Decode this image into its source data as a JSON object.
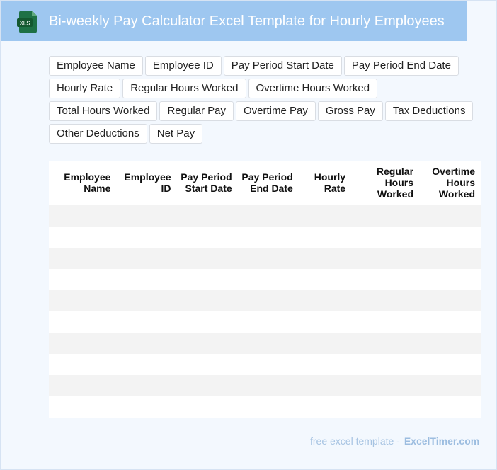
{
  "header": {
    "title": "Bi-weekly Pay Calculator Excel Template for Hourly Employees",
    "icon_label": "XLS",
    "icon_name": "excel-file-icon",
    "accent_color": "#9ec7f0",
    "icon_color": "#1e7145"
  },
  "fields": [
    "Employee Name",
    "Employee ID",
    "Pay Period Start Date",
    "Pay Period End Date",
    "Hourly Rate",
    "Regular Hours Worked",
    "Overtime Hours Worked",
    "Total Hours Worked",
    "Regular Pay",
    "Overtime Pay",
    "Gross Pay",
    "Tax Deductions",
    "Other Deductions",
    "Net Pay"
  ],
  "table": {
    "columns": [
      "Employee Name",
      "Employee ID",
      "Pay Period Start Date",
      "Pay Period End Date",
      "Hourly Rate",
      "Regular Hours Worked",
      "Overtime Hours Worked"
    ],
    "row_count": 10
  },
  "footer": {
    "prefix": "free excel template -",
    "brand": "ExcelTimer.com"
  }
}
